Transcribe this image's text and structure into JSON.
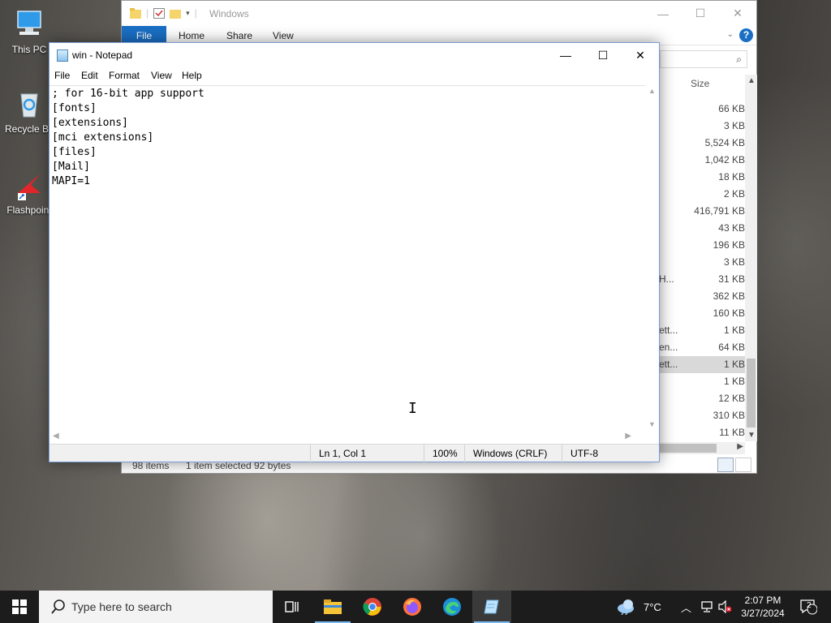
{
  "desktop": {
    "icons": [
      {
        "label": "This PC",
        "icon": "computer-icon"
      },
      {
        "label": "Recycle Bin",
        "icon": "recycle-bin-icon"
      },
      {
        "label": "Flashpoint",
        "icon": "flashpoint-shortcut-icon"
      }
    ]
  },
  "explorer": {
    "title": "Windows",
    "ribbon_tabs": [
      "File",
      "Home",
      "Share",
      "View"
    ],
    "size_header": "Size",
    "rows": [
      {
        "name": "",
        "size": "66 KB"
      },
      {
        "name": "",
        "size": "3 KB"
      },
      {
        "name": "",
        "size": "5,524 KB"
      },
      {
        "name": "",
        "size": "1,042 KB"
      },
      {
        "name": "",
        "size": "18 KB"
      },
      {
        "name": "",
        "size": "2 KB"
      },
      {
        "name": "",
        "size": "416,791 KB"
      },
      {
        "name": "",
        "size": "43 KB"
      },
      {
        "name": "",
        "size": "196 KB"
      },
      {
        "name": "",
        "size": "3 KB"
      },
      {
        "name": "H...",
        "size": "31 KB"
      },
      {
        "name": "",
        "size": "362 KB"
      },
      {
        "name": "",
        "size": "160 KB"
      },
      {
        "name": "ett...",
        "size": "1 KB"
      },
      {
        "name": "en...",
        "size": "64 KB"
      },
      {
        "name": "ett...",
        "size": "1 KB",
        "selected": true
      },
      {
        "name": "",
        "size": "1 KB"
      },
      {
        "name": "",
        "size": "12 KB"
      },
      {
        "name": "",
        "size": "310 KB"
      },
      {
        "name": "",
        "size": "11 KB"
      }
    ],
    "status": {
      "items": "98 items",
      "selected": "1 item selected  92 bytes"
    }
  },
  "notepad": {
    "title": "win - Notepad",
    "menu": [
      "File",
      "Edit",
      "Format",
      "View",
      "Help"
    ],
    "content": "; for 16-bit app support\n[fonts]\n[extensions]\n[mci extensions]\n[files]\n[Mail]\nMAPI=1",
    "status": {
      "position": "Ln 1, Col 1",
      "zoom": "100%",
      "line_ending": "Windows (CRLF)",
      "encoding": "UTF-8"
    }
  },
  "taskbar": {
    "search_placeholder": "Type here to search",
    "apps": [
      "task-view-icon",
      "file-explorer-icon",
      "chrome-icon",
      "firefox-icon",
      "edge-icon",
      "notepad-icon"
    ],
    "weather": "7°C",
    "time": "2:07 PM",
    "date": "3/27/2024",
    "notification_count": "2"
  }
}
